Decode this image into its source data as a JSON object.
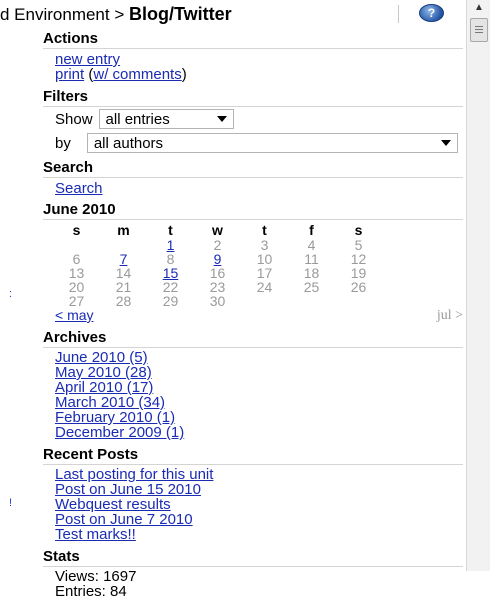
{
  "header": {
    "crumb_prefix": "d Environment > ",
    "site_title": "Blog/Twitter",
    "help_icon": "help-icon"
  },
  "actions": {
    "title": "Actions",
    "new_entry": "new entry",
    "print": "print",
    "paren_open": " (",
    "with_comments": "w/ comments",
    "paren_close": ")"
  },
  "filters": {
    "title": "Filters",
    "show_label": "Show",
    "show_value": "all entries",
    "by_label": "by",
    "by_value": "all authors"
  },
  "search": {
    "title": "Search",
    "link": "Search"
  },
  "calendar": {
    "title": "June 2010",
    "weekdays": [
      "s",
      "m",
      "t",
      "w",
      "t",
      "f",
      "s"
    ],
    "weeks": [
      [
        {
          "d": ""
        },
        {
          "d": ""
        },
        {
          "d": "1",
          "link": true
        },
        {
          "d": "2"
        },
        {
          "d": "3"
        },
        {
          "d": "4"
        },
        {
          "d": "5"
        }
      ],
      [
        {
          "d": "6"
        },
        {
          "d": "7",
          "link": true
        },
        {
          "d": "8"
        },
        {
          "d": "9",
          "link": true
        },
        {
          "d": "10"
        },
        {
          "d": "11"
        },
        {
          "d": "12"
        }
      ],
      [
        {
          "d": "13"
        },
        {
          "d": "14"
        },
        {
          "d": "15",
          "link": true
        },
        {
          "d": "16"
        },
        {
          "d": "17"
        },
        {
          "d": "18"
        },
        {
          "d": "19"
        }
      ],
      [
        {
          "d": "20"
        },
        {
          "d": "21"
        },
        {
          "d": "22"
        },
        {
          "d": "23"
        },
        {
          "d": "24"
        },
        {
          "d": "25"
        },
        {
          "d": "26"
        }
      ],
      [
        {
          "d": "27"
        },
        {
          "d": "28"
        },
        {
          "d": "29"
        },
        {
          "d": "30"
        },
        {
          "d": ""
        },
        {
          "d": ""
        },
        {
          "d": ""
        }
      ]
    ],
    "prev": "< may",
    "next": "jul >"
  },
  "archives": {
    "title": "Archives",
    "items": [
      "June 2010 (5)",
      "May 2010 (28)",
      "April 2010 (17)",
      "March 2010 (34)",
      "February 2010 (1)",
      "December 2009 (1)"
    ]
  },
  "recent_posts": {
    "title": "Recent Posts",
    "items": [
      "Last posting for this unit",
      "Post on June 15 2010",
      "Webquest results",
      "Post on June 7 2010",
      "Test marks!!"
    ]
  },
  "stats": {
    "title": "Stats",
    "views": "Views: 1697",
    "entries": "Entries: 84"
  },
  "colors": {
    "link": "#1a2bb4",
    "muted": "#9a9a9a"
  }
}
